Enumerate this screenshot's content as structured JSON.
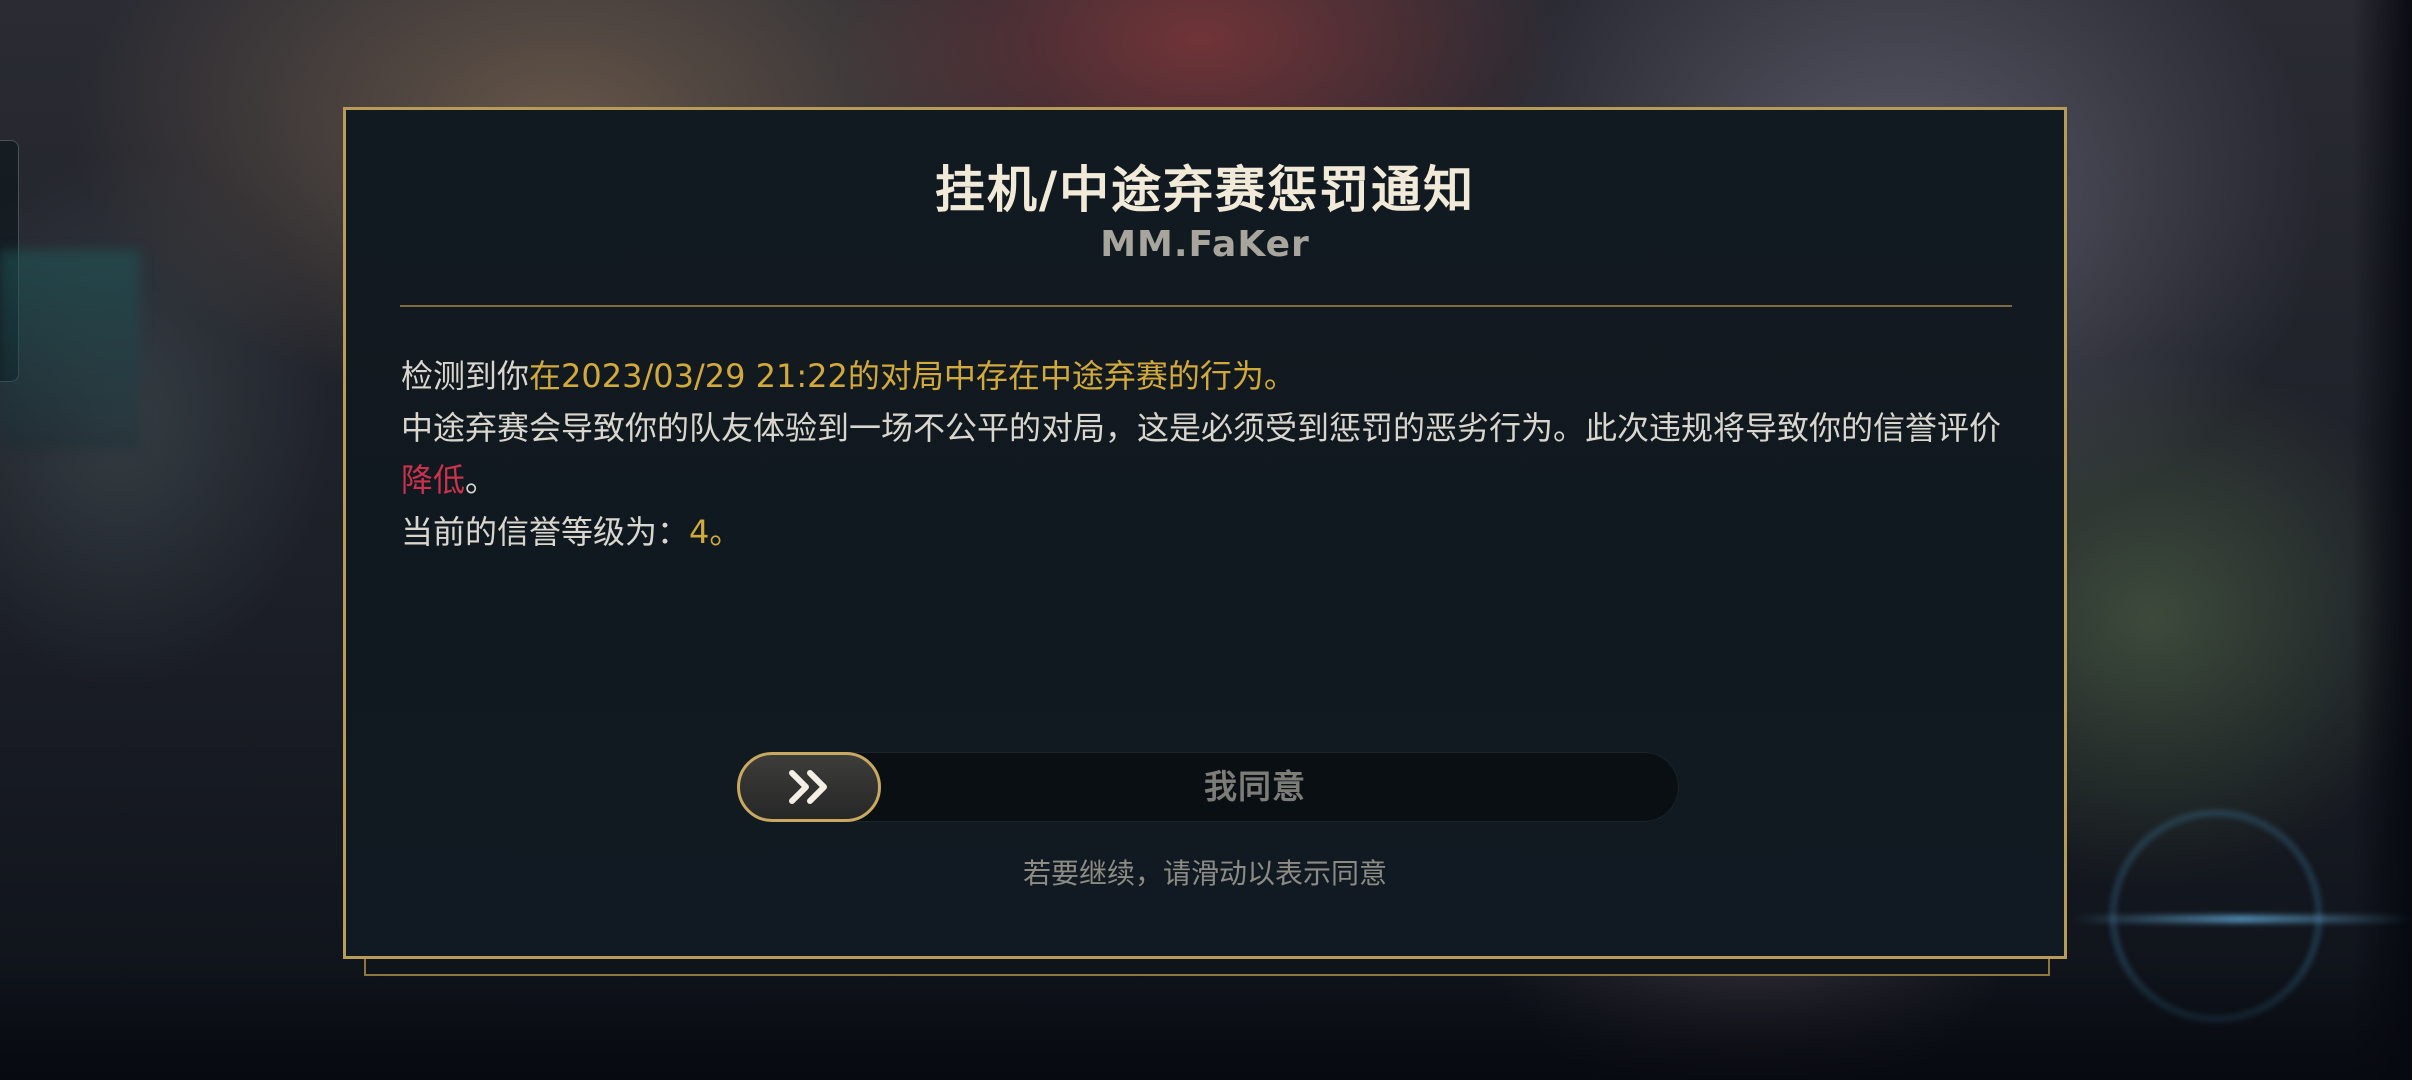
{
  "dialog": {
    "title": "挂机/中途弃赛惩罚通知",
    "summoner_name": "MM.FaKer",
    "body": {
      "line1_prefix": "检测到你",
      "line1_highlight": "在2023/03/29 21:22的对局中存在中途弃赛的行为。",
      "line2_text": "中途弃赛会导致你的队友体验到一场不公平的对局，这是必须受到惩罚的恶劣行为。此次违规将导致你的信誉评价",
      "line2_highlight": "降低",
      "line2_suffix": "。",
      "line3_label": "当前的信誉等级为：",
      "line3_value": "4",
      "line3_suffix": "。"
    },
    "slider": {
      "handle_icon": "double-chevron-right-icon",
      "label": "我同意",
      "progress": 0
    },
    "hint": "若要继续，请滑动以表示同意"
  },
  "colors": {
    "frame_gold": "#b79b56",
    "highlight_gold": "#d2a93b",
    "highlight_red": "#c8324a",
    "title_text": "#f1ead8"
  }
}
